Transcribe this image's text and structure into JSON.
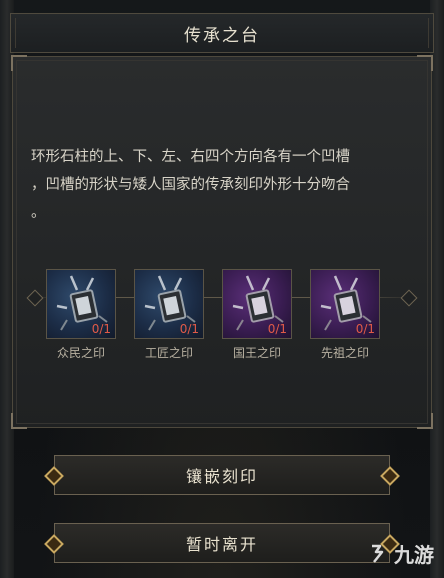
{
  "title": "传承之台",
  "description": "环形石柱的上、下、左、右四个方向各有一个凹槽\n，凹槽的形状与矮人国家的传承刻印外形十分吻合\n。",
  "seals": [
    {
      "name": "众民之印",
      "count": "0/1",
      "color": "blue"
    },
    {
      "name": "工匠之印",
      "count": "0/1",
      "color": "blue"
    },
    {
      "name": "国王之印",
      "count": "0/1",
      "color": "purple"
    },
    {
      "name": "先祖之印",
      "count": "0/1",
      "color": "purple"
    }
  ],
  "buttons": {
    "inlay": "镶嵌刻印",
    "leave": "暂时离开"
  },
  "watermark": {
    "text": "九游",
    "icon": "jiuyou-logo-icon"
  }
}
